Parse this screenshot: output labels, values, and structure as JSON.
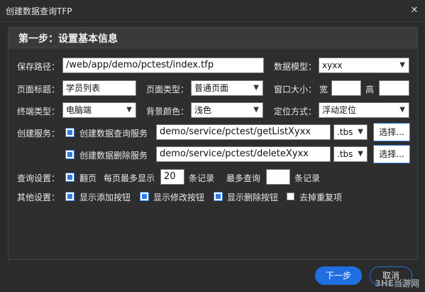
{
  "window": {
    "title": "创建数据查询TFP",
    "close_glyph": "✕"
  },
  "panel": {
    "heading": "第一步：设置基本信息"
  },
  "row1": {
    "save_path_label": "保存路径：",
    "save_path_value": "/web/app/demo/pctest/index.tfp",
    "model_label": "数据模型：",
    "model_value": "xyxx"
  },
  "row2": {
    "page_title_label": "页面标题：",
    "page_title_value": "学员列表",
    "page_type_label": "页面类型：",
    "page_type_value": "普通页面",
    "window_size_label": "窗口大小：",
    "width_label": "宽",
    "width_value": "",
    "height_label": "高",
    "height_value": ""
  },
  "row3": {
    "terminal_label": "终端类型：",
    "terminal_value": "电脑端",
    "bg_label": "背景颜色：",
    "bg_value": "浅色",
    "position_label": "定位方式：",
    "position_value": "浮动定位"
  },
  "service": {
    "label": "创建服务：",
    "query_label": "创建数据查询服务",
    "query_checked": true,
    "query_path": "demo/service/pctest/getListXyxx",
    "query_ext": ".tbs",
    "query_select": "选择...",
    "delete_label": "创建数据删除服务",
    "delete_checked": true,
    "delete_path": "demo/service/pctest/deleteXyxx",
    "delete_ext": ".tbs",
    "delete_select": "选择..."
  },
  "query": {
    "label": "查询设置：",
    "paging_label": "翻页",
    "paging_checked": true,
    "per_page_label": "每页最多显示",
    "per_page_value": "20",
    "per_page_unit": "条记录",
    "max_label": "最多查询",
    "max_value": "",
    "max_unit": "条记录"
  },
  "other": {
    "label": "其他设置：",
    "add_label": "显示添加按钮",
    "add_checked": true,
    "edit_label": "显示修改按钮",
    "edit_checked": true,
    "del_label": "显示删除按钮",
    "del_checked": true,
    "dedup_label": "去掉重复项",
    "dedup_checked": false
  },
  "footer": {
    "next_label": "下一步",
    "cancel_label": "取消"
  },
  "watermark": "3HE当游网",
  "colors": {
    "accent": "#1f6fe0",
    "background": "#2b2b2b"
  }
}
